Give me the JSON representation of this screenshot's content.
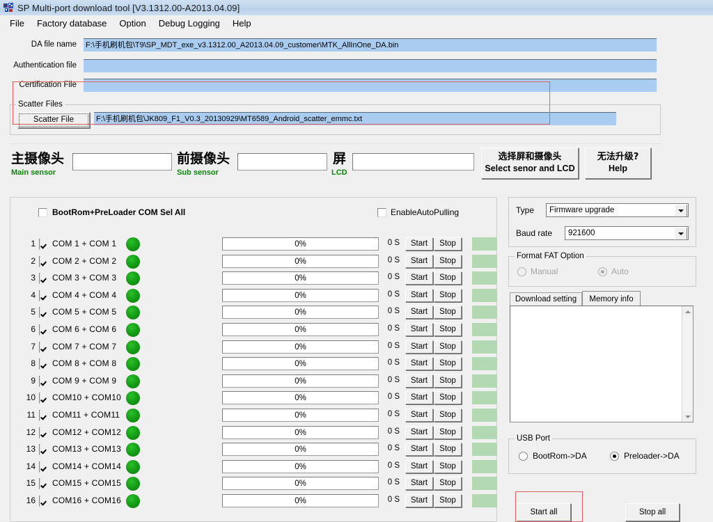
{
  "window": {
    "title": "SP Multi-port download tool [V3.1312.00-A2013.04.09]",
    "icon": "app-icon"
  },
  "menu": {
    "items": [
      {
        "label": "File"
      },
      {
        "label": "Factory database"
      },
      {
        "label": "Option"
      },
      {
        "label": "Debug Logging"
      },
      {
        "label": "Help"
      }
    ]
  },
  "files": {
    "da_label": "DA file name",
    "da_value": "F:\\手机刷机包\\T9\\SP_MDT_exe_v3.1312.00_A2013.04.09_customer\\MTK_AllInOne_DA.bin",
    "auth_label": "Authentication file",
    "auth_value": "",
    "cert_label": "Certification File",
    "cert_value": "",
    "scatter_group_label": "Scatter Files",
    "scatter_button": "Scatter File",
    "scatter_value": "F:\\手机刷机包\\JK809_F1_V0.3_20130929\\MT6589_Android_scatter_emmc.txt"
  },
  "sensors": {
    "main_cn": "主摄像头",
    "main_en": "Main sensor",
    "main_value": "",
    "sub_cn": "前摄像头",
    "sub_en": "Sub sensor",
    "sub_value": "",
    "lcd_cn": "屏",
    "lcd_en": "LCD",
    "lcd_value": "",
    "select_btn_cn": "选择屏和摄像头",
    "select_btn_en": "Select senor and LCD",
    "help_btn_cn": "无法升级?",
    "help_btn_en": "Help"
  },
  "ports": {
    "select_all_label": "BootRom+PreLoader COM Sel All",
    "select_all_checked": false,
    "auto_pulling_label": "EnableAutoPulling",
    "auto_pulling_checked": false,
    "start_label": "Start",
    "stop_label": "Stop",
    "rows": [
      {
        "index": "1",
        "label": "COM 1 + COM 1",
        "checked": true,
        "led": "green",
        "progress": "0%",
        "seconds": "0 S"
      },
      {
        "index": "2",
        "label": "COM 2 + COM 2",
        "checked": true,
        "led": "green",
        "progress": "0%",
        "seconds": "0 S"
      },
      {
        "index": "3",
        "label": "COM 3 + COM 3",
        "checked": true,
        "led": "green",
        "progress": "0%",
        "seconds": "0 S"
      },
      {
        "index": "4",
        "label": "COM 4 + COM 4",
        "checked": true,
        "led": "green",
        "progress": "0%",
        "seconds": "0 S"
      },
      {
        "index": "5",
        "label": "COM 5 + COM 5",
        "checked": true,
        "led": "green",
        "progress": "0%",
        "seconds": "0 S"
      },
      {
        "index": "6",
        "label": "COM 6 + COM 6",
        "checked": true,
        "led": "green",
        "progress": "0%",
        "seconds": "0 S"
      },
      {
        "index": "7",
        "label": "COM 7 + COM 7",
        "checked": true,
        "led": "green",
        "progress": "0%",
        "seconds": "0 S"
      },
      {
        "index": "8",
        "label": "COM 8 + COM 8",
        "checked": true,
        "led": "green",
        "progress": "0%",
        "seconds": "0 S"
      },
      {
        "index": "9",
        "label": "COM 9 + COM 9",
        "checked": true,
        "led": "green",
        "progress": "0%",
        "seconds": "0 S"
      },
      {
        "index": "10",
        "label": "COM10 + COM10",
        "checked": true,
        "led": "green",
        "progress": "0%",
        "seconds": "0 S"
      },
      {
        "index": "11",
        "label": "COM11 + COM11",
        "checked": true,
        "led": "green",
        "progress": "0%",
        "seconds": "0 S"
      },
      {
        "index": "12",
        "label": "COM12 + COM12",
        "checked": true,
        "led": "green",
        "progress": "0%",
        "seconds": "0 S"
      },
      {
        "index": "13",
        "label": "COM13 + COM13",
        "checked": true,
        "led": "green",
        "progress": "0%",
        "seconds": "0 S"
      },
      {
        "index": "14",
        "label": "COM14 + COM14",
        "checked": true,
        "led": "green",
        "progress": "0%",
        "seconds": "0 S"
      },
      {
        "index": "15",
        "label": "COM15 + COM15",
        "checked": true,
        "led": "green",
        "progress": "0%",
        "seconds": "0 S"
      },
      {
        "index": "16",
        "label": "COM16 + COM16",
        "checked": true,
        "led": "green",
        "progress": "0%",
        "seconds": "0 S"
      }
    ]
  },
  "settings": {
    "type_label": "Type",
    "type_value": "Firmware upgrade",
    "baud_label": "Baud rate",
    "baud_value": "921600",
    "format_group_label": "Format FAT Option",
    "format_manual": "Manual",
    "format_auto": "Auto",
    "format_selected": "Auto",
    "format_disabled": true,
    "tabs": [
      {
        "label": "Download setting",
        "active": false
      },
      {
        "label": "Memory info",
        "active": true
      }
    ],
    "memo_value": "",
    "usb_group_label": "USB Port",
    "usb_bootrom": "BootRom->DA",
    "usb_preloader": "Preloader->DA",
    "usb_selected": "Preloader->DA",
    "start_all": "Start all",
    "stop_all": "Stop all"
  },
  "colors": {
    "accent_blue": "#aaccf0",
    "led_green": "#17a017",
    "status_green": "#b3d9b3",
    "label_green": "#0a8a0a",
    "annotation_red": "#e06060",
    "window_bg": "#f0f0f0"
  }
}
